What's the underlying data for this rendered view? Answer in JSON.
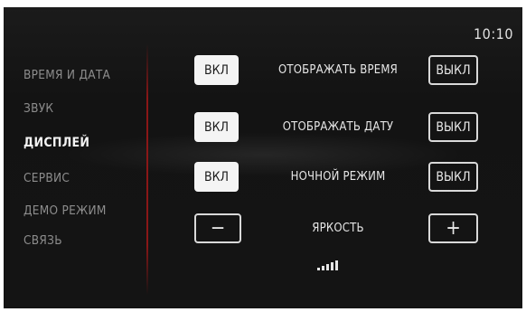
{
  "status": {
    "time": "10:10"
  },
  "menu": {
    "items": [
      {
        "label": "ВРЕМЯ И ДАТА",
        "active": false
      },
      {
        "label": "ЗВУК",
        "active": false
      },
      {
        "label": "ДИСПЛЕЙ",
        "active": true
      },
      {
        "label": "СЕРВИС",
        "active": false
      },
      {
        "label": "ДЕМО РЕЖИМ",
        "active": false
      },
      {
        "label": "СВЯЗЬ",
        "active": false
      }
    ]
  },
  "settings": {
    "rows": [
      {
        "label": "ОТОБРАЖАТЬ ВРЕМЯ",
        "on_label": "ВКЛ",
        "off_label": "ВЫКЛ"
      },
      {
        "label": "ОТОБРАЖАТЬ ДАТУ",
        "on_label": "ВКЛ",
        "off_label": "ВЫКЛ"
      },
      {
        "label": "НОЧНОЙ РЕЖИМ",
        "on_label": "ВКЛ",
        "off_label": "ВЫКЛ"
      }
    ],
    "brightness": {
      "label": "ЯРКОСТЬ",
      "decrease_symbol": "−",
      "increase_symbol": "+",
      "level": 5,
      "max_level": 5
    }
  },
  "colors": {
    "background": "#151515",
    "divider": "#8a1717",
    "active_text": "#f4f4f4",
    "inactive_text": "#8d8d8d"
  }
}
